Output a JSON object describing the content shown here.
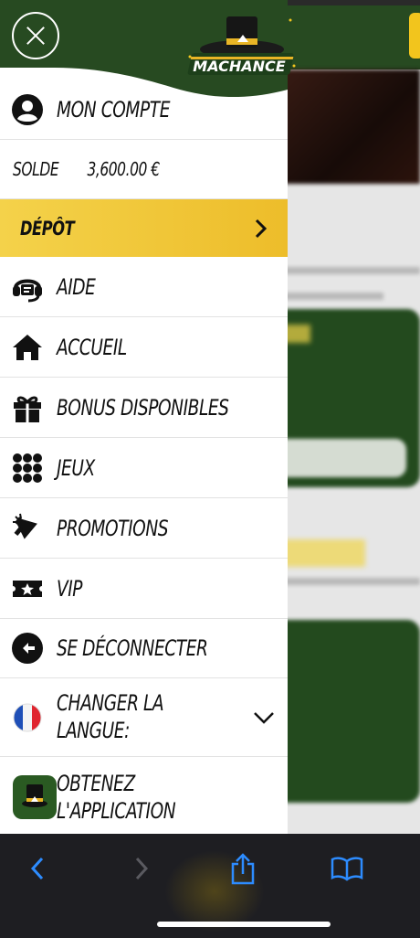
{
  "header": {
    "logo_text": "MACHANCE",
    "close_icon": "close-icon"
  },
  "colors": {
    "brand_green": "#274a21",
    "accent_gold": "#f2c51d",
    "link_blue": "#2d8cff"
  },
  "menu": {
    "account_label": "MON COMPTE",
    "balance_label": "SOLDE",
    "balance_value": "3,600.00 €",
    "deposit_label": "DÉPÔT",
    "items": [
      {
        "label": "AIDE",
        "icon": "support-headset-icon"
      },
      {
        "label": "ACCUEIL",
        "icon": "home-icon"
      },
      {
        "label": "BONUS DISPONIBLES",
        "icon": "gift-icon"
      },
      {
        "label": "JEUX",
        "icon": "grid-dots-icon"
      },
      {
        "label": "PROMOTIONS",
        "icon": "megaphone-icon"
      },
      {
        "label": "VIP",
        "icon": "vip-ticket-icon"
      },
      {
        "label": "SE DÉCONNECTER",
        "icon": "logout-icon"
      }
    ],
    "language_label": "CHANGER LA LANGUE:",
    "language_flag": "france-flag-icon",
    "app_label": "OBTENEZ L'APPLICATION"
  },
  "browser_toolbar": {
    "back": "back-chevron-icon",
    "forward": "forward-chevron-icon",
    "share": "share-icon",
    "bookmarks": "bookmarks-icon"
  }
}
